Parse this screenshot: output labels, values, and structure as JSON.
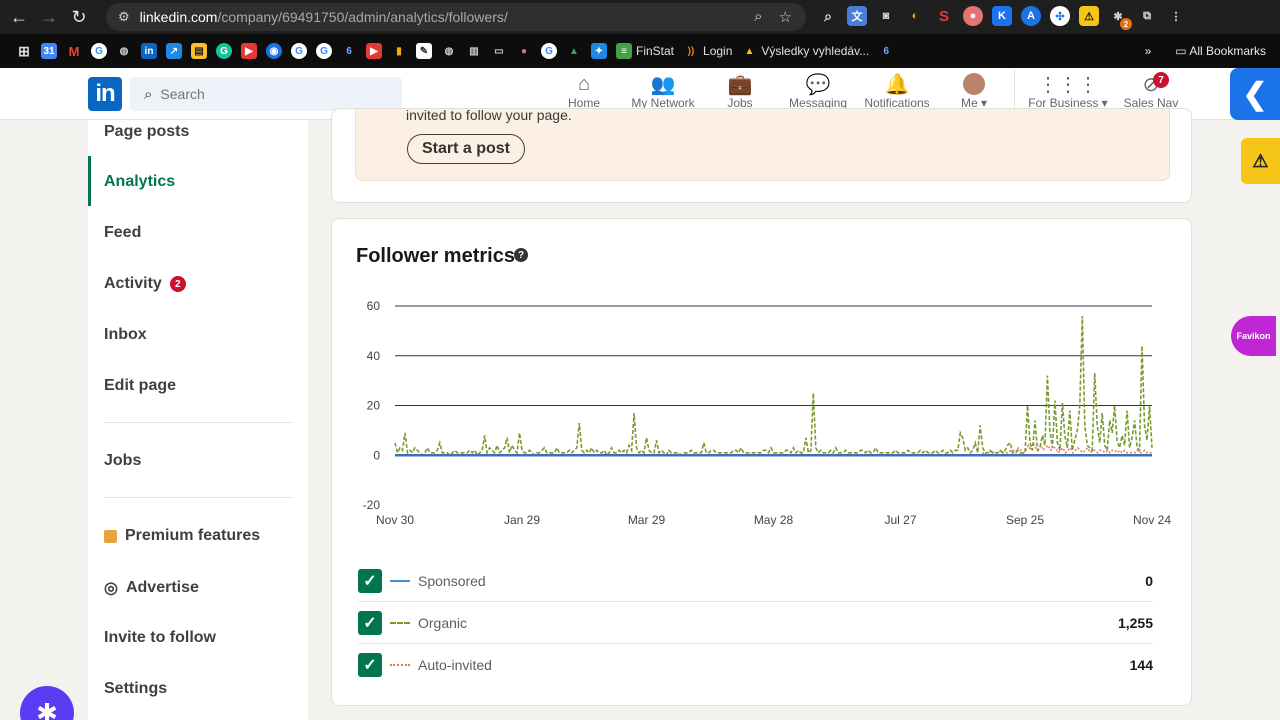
{
  "browser": {
    "url_host": "linkedin.com",
    "url_path": "/company/69491750/admin/analytics/followers/",
    "ext_badge": "2",
    "bookmarks": [
      {
        "label": "FinStat"
      },
      {
        "label": "Login"
      },
      {
        "label": "Výsledky vyhledáv..."
      }
    ],
    "all_bookmarks": "All Bookmarks"
  },
  "header": {
    "logo": "in",
    "search_placeholder": "Search",
    "nav": {
      "home": "Home",
      "network": "My Network",
      "jobs": "Jobs",
      "messaging": "Messaging",
      "notifications": "Notifications",
      "me": "Me",
      "business": "For Business",
      "salesnav": "Sales Nav"
    },
    "salesnav_badge": "7"
  },
  "sidebar": {
    "items": [
      {
        "label": "Page posts"
      },
      {
        "label": "Analytics"
      },
      {
        "label": "Feed"
      },
      {
        "label": "Activity",
        "badge": "2"
      },
      {
        "label": "Inbox"
      },
      {
        "label": "Edit page"
      },
      {
        "label": "Jobs"
      },
      {
        "label": "Premium features"
      },
      {
        "label": "Advertise"
      },
      {
        "label": "Invite to follow"
      },
      {
        "label": "Settings"
      }
    ]
  },
  "banner": {
    "text": "invited to follow your page.",
    "button": "Start a post"
  },
  "favikon": "Favikon",
  "metrics": {
    "title": "Follower metrics",
    "legend": [
      {
        "name": "Sponsored",
        "value": "0",
        "color": "#4a8fd6"
      },
      {
        "name": "Organic",
        "value": "1,255",
        "color": "#7a9a2e"
      },
      {
        "name": "Auto-invited",
        "value": "144",
        "color": "#e07a5f"
      }
    ]
  },
  "chart_data": {
    "type": "line",
    "ylim": [
      -20,
      60
    ],
    "yticks": [
      "60",
      "40",
      "20",
      "0",
      "-20"
    ],
    "xticks": [
      "Nov 30",
      "Jan 29",
      "Mar 29",
      "May 28",
      "Jul 27",
      "Sep 25",
      "Nov 24"
    ],
    "series": [
      {
        "name": "Organic",
        "color": "#7a9a2e",
        "values": [
          5,
          1,
          3,
          2,
          9,
          1,
          2,
          1,
          3,
          2,
          1,
          0,
          1,
          3,
          1,
          1,
          1,
          2,
          5,
          1,
          1,
          1,
          0,
          1,
          2,
          1,
          1,
          1,
          1,
          1,
          2,
          1,
          2,
          0,
          1,
          2,
          8,
          1,
          3,
          2,
          1,
          4,
          1,
          2,
          3,
          7,
          1,
          4,
          2,
          1,
          9,
          2,
          1,
          1,
          2,
          1,
          0,
          1,
          1,
          2,
          3,
          1,
          1,
          1,
          1,
          3,
          1,
          1,
          1,
          1,
          2,
          1,
          2,
          3,
          13,
          2,
          1,
          2,
          1,
          3,
          1,
          2,
          1,
          1,
          2,
          0,
          1,
          3,
          1,
          1,
          2,
          1,
          2,
          1,
          4,
          2,
          17,
          3,
          1,
          2,
          1,
          7,
          2,
          1,
          1,
          6,
          1,
          2,
          1,
          0,
          2,
          1,
          1,
          1,
          1,
          0,
          1,
          1,
          1,
          2,
          1,
          1,
          1,
          1,
          5,
          1,
          1,
          2,
          2,
          1,
          1,
          1,
          1,
          1,
          1,
          1,
          2,
          2,
          1,
          3,
          1,
          1,
          1,
          1,
          1,
          1,
          1,
          1,
          2,
          2,
          1,
          3,
          1,
          1,
          1,
          1,
          1,
          2,
          2,
          1,
          3,
          1,
          2,
          1,
          1,
          7,
          1,
          2,
          25,
          3,
          1,
          2,
          1,
          1,
          1,
          2,
          1,
          3,
          1,
          1,
          1,
          2,
          1,
          1,
          1,
          1,
          1,
          2,
          2,
          1,
          2,
          1,
          1,
          3,
          1,
          1,
          1,
          1,
          1,
          1,
          1,
          2,
          1,
          1,
          1,
          1,
          2,
          1,
          1,
          1,
          1,
          2,
          1,
          2,
          1,
          1,
          1,
          2,
          1,
          1,
          2,
          1,
          1,
          2,
          1,
          2,
          2,
          9,
          7,
          2,
          3,
          1,
          2,
          5,
          1,
          12,
          3,
          1,
          1,
          2,
          1,
          1,
          1,
          2,
          1,
          2,
          4,
          5,
          1,
          1,
          2,
          1,
          1,
          1,
          20,
          5,
          2,
          14,
          2,
          3,
          8,
          4,
          32,
          10,
          3,
          22,
          5,
          2,
          21,
          8,
          3,
          18,
          2,
          6,
          10,
          20,
          56,
          12,
          4,
          3,
          2,
          33,
          12,
          5,
          17,
          4,
          2,
          14,
          9,
          20,
          6,
          3,
          8,
          4,
          18,
          3,
          7,
          14,
          3,
          2,
          44,
          12,
          6,
          20,
          3
        ],
        "x_ticks_indices": [
          0,
          50,
          100,
          150,
          200,
          250,
          300
        ]
      },
      {
        "name": "Auto-invited",
        "color": "#e07a5f",
        "values": [
          0,
          0,
          0,
          0,
          0,
          0,
          0,
          0,
          0,
          0,
          0,
          0,
          0,
          0,
          0,
          0,
          0,
          0,
          0,
          0,
          0,
          0,
          0,
          0,
          0,
          0,
          0,
          0,
          0,
          0,
          0,
          0,
          0,
          0,
          0,
          0,
          0,
          0,
          0,
          0,
          0,
          0,
          0,
          0,
          0,
          0,
          0,
          0,
          0,
          0,
          0,
          0,
          0,
          0,
          0,
          0,
          0,
          0,
          0,
          0,
          0,
          0,
          0,
          0,
          0,
          0,
          0,
          0,
          0,
          0,
          0,
          0,
          0,
          0,
          0,
          0,
          0,
          0,
          0,
          0,
          0,
          0,
          0,
          0,
          0,
          0,
          0,
          0,
          0,
          0,
          0,
          0,
          0,
          0,
          0,
          0,
          0,
          0,
          0,
          0,
          0,
          0,
          0,
          0,
          0,
          0,
          0,
          0,
          0,
          0,
          0,
          0,
          0,
          0,
          0,
          0,
          0,
          0,
          0,
          0,
          0,
          0,
          0,
          0,
          0,
          0,
          0,
          0,
          0,
          0,
          0,
          0,
          0,
          0,
          0,
          0,
          0,
          0,
          0,
          0,
          0,
          0,
          0,
          0,
          0,
          0,
          0,
          0,
          0,
          0,
          0,
          0,
          0,
          0,
          0,
          0,
          0,
          0,
          0,
          0,
          0,
          0,
          0,
          0,
          0,
          0,
          0,
          0,
          0,
          0,
          0,
          0,
          0,
          0,
          0,
          0,
          0,
          0,
          0,
          0,
          0,
          0,
          0,
          0,
          0,
          0,
          0,
          0,
          0,
          0,
          0,
          0,
          0,
          0,
          0,
          0,
          0,
          0,
          0,
          0,
          0,
          0,
          0,
          0,
          0,
          0,
          0,
          0,
          0,
          0,
          0,
          0,
          0,
          0,
          0,
          0,
          0,
          0,
          0,
          0,
          0,
          0,
          0,
          0,
          0,
          0,
          0,
          0,
          0,
          0,
          0,
          0,
          0,
          0,
          0,
          0,
          0,
          0,
          1,
          1,
          1,
          2,
          1,
          1,
          1,
          2,
          1,
          1,
          1,
          2,
          2,
          1,
          3,
          2,
          1,
          2,
          4,
          2,
          5,
          3,
          2,
          4,
          2,
          3,
          4,
          2,
          3,
          3,
          1,
          2,
          3,
          1,
          2,
          3,
          1,
          2,
          3,
          2,
          1,
          2,
          3,
          1,
          2,
          2,
          1,
          2,
          2,
          1,
          2,
          1,
          2,
          2,
          1,
          2,
          1,
          2,
          1,
          1,
          1,
          1,
          2,
          1,
          1,
          2,
          1,
          1,
          1
        ]
      },
      {
        "name": "Sponsored",
        "color": "#3f6fb5",
        "values": "all zero"
      }
    ]
  }
}
